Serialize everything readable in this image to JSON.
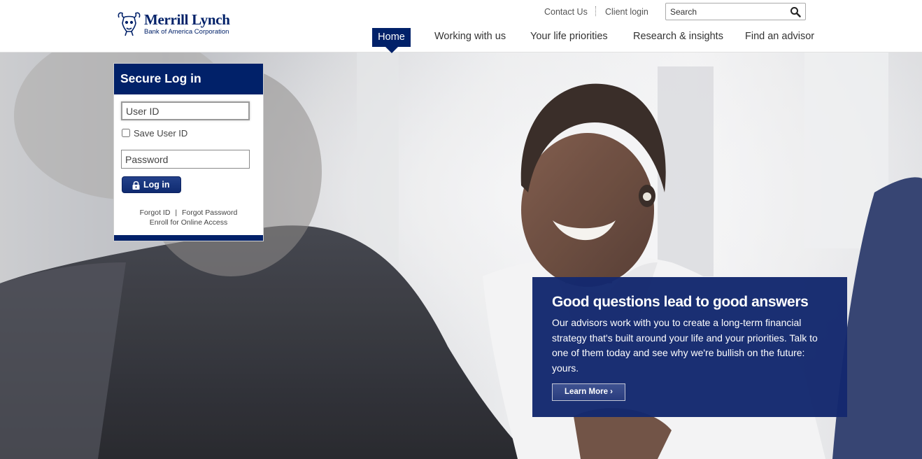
{
  "header": {
    "brand": {
      "name": "Merrill Lynch",
      "subtitle": "Bank of America Corporation"
    },
    "utility": {
      "contact_us": "Contact Us",
      "client_login": "Client login",
      "search_placeholder": "Search"
    },
    "nav": {
      "home": "Home",
      "working_with_us": "Working with us",
      "life_priorities": "Your life priorities",
      "research": "Research & insights",
      "find_advisor": "Find an advisor"
    }
  },
  "login": {
    "title": "Secure Log in",
    "user_id_placeholder": "User ID",
    "save_user_id": "Save User ID",
    "password_placeholder": "Password",
    "button": "Log in",
    "forgot_id": "Forgot ID",
    "forgot_password": "Forgot Password",
    "separator": "|",
    "enroll": "Enroll for Online Access"
  },
  "promo": {
    "title": "Good questions lead to good answers",
    "body": "Our advisors work with you to create a long-term financial strategy that's built around your life and your priorities. Talk to one of them today and see why we're bullish on the future: yours.",
    "button": "Learn More ›"
  },
  "colors": {
    "brand_navy": "#012169",
    "promo_navy": "#14296f",
    "header_bg": "#ffffff"
  }
}
